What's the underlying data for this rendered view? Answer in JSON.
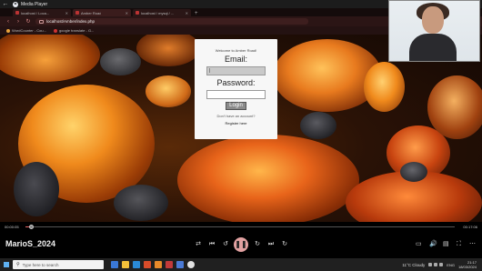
{
  "media_player": {
    "window_title": "Media Player",
    "now_playing": "MarioS_2024",
    "time_elapsed": "00:00:05",
    "time_total": "00:17:06",
    "progress_fraction": 0.013,
    "accent_color": "#e2a1a1"
  },
  "browser": {
    "tabs": [
      {
        "label": "localhost / Loca...",
        "active": false
      },
      {
        "label": "Amber Road",
        "active": true
      },
      {
        "label": "localhost / mysql / ...",
        "active": false
      }
    ],
    "url": "localhost/Amber/index.php",
    "bookmarks": [
      "WordCounter - Cou...",
      "google translate - G..."
    ],
    "theme_color": "#2b1515"
  },
  "login": {
    "welcome": "Welcome to Amber Road!",
    "email_label": "Email:",
    "email_value": "|",
    "password_label": "Password:",
    "password_value": "",
    "login_button": "Login",
    "no_account": "Don't have an account?",
    "register": "Register here"
  },
  "taskbar": {
    "search_placeholder": "Type here to search",
    "weather": "11°C  Cloudy",
    "language": "ENG",
    "time": "21:17",
    "date": "18/03/2024"
  }
}
